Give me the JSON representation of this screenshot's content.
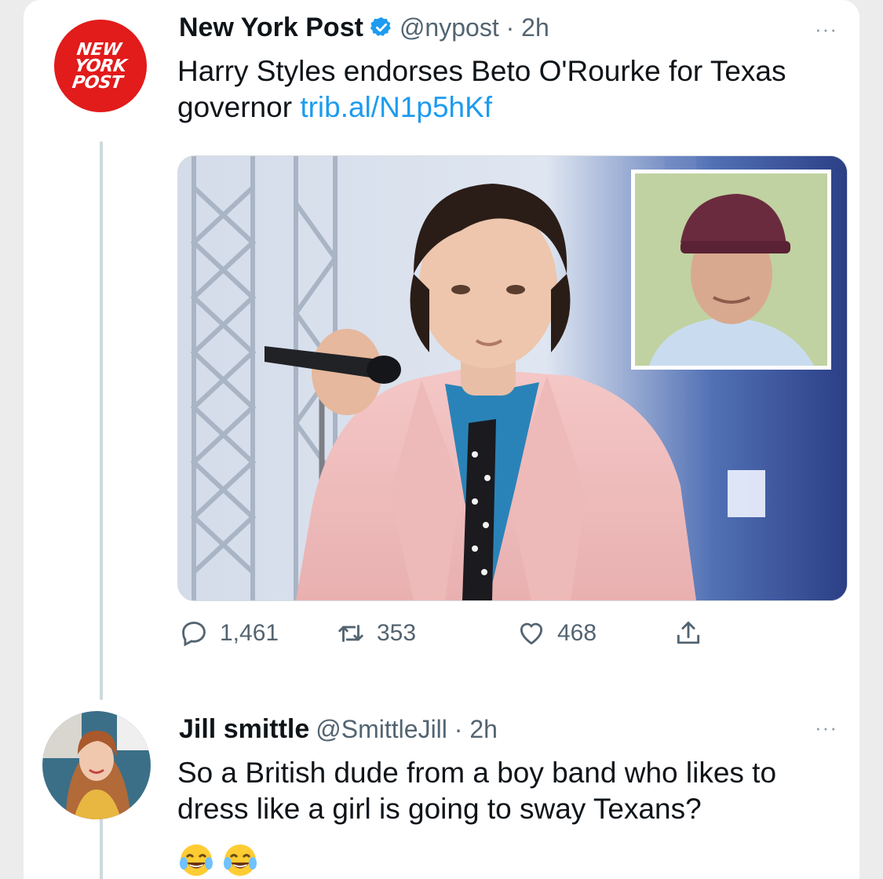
{
  "tweet": {
    "author_name": "New York Post",
    "handle_time": "@nypost · 2h",
    "avatar_logo_lines": [
      "NEW",
      "YORK",
      "POST"
    ],
    "text": "Harry Styles endorses Beto O'Rourke for Texas governor",
    "link": "trib.al/N1p5hKf",
    "more_label": "···",
    "stats": {
      "replies": "1,461",
      "retweets": "353",
      "likes": "468"
    }
  },
  "reply": {
    "author_name": "Jill smittle",
    "handle_time": "@SmittleJill · 2h",
    "text": "So a British dude from a boy band who likes to dress like a girl is going to sway Texans?",
    "more_label": "···",
    "emoji": [
      "tears-of-joy",
      "tears-of-joy"
    ]
  },
  "colors": {
    "brand_red": "#e21b1b",
    "link_blue": "#1d9bf0",
    "verified_blue": "#1d9bf0",
    "secondary_text": "#536471"
  },
  "icons": [
    "verified-icon",
    "more-icon",
    "reply-icon",
    "retweet-icon",
    "like-icon",
    "share-icon"
  ]
}
